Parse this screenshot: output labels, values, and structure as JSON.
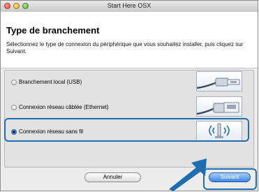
{
  "window": {
    "title": "Start Here OSX"
  },
  "header": {
    "heading": "Type de branchement",
    "subtitle": "Sélectionnez le type de connexion du périphérique que vous souhaitez installer, puis cliquez sur Suivant."
  },
  "options": [
    {
      "label": "Branchement local (USB)",
      "selected": false,
      "icon": "usb-cable-icon"
    },
    {
      "label": "Connexion réseau câblée (Ethernet)",
      "selected": false,
      "icon": "ethernet-cable-icon"
    },
    {
      "label": "Connexion réseau sans fil",
      "selected": true,
      "icon": "wireless-access-point-icon"
    }
  ],
  "buttons": {
    "cancel": "Annuler",
    "next": "Suivant"
  },
  "colors": {
    "highlight": "#1e6db0",
    "next_button": "#3a86e2"
  }
}
